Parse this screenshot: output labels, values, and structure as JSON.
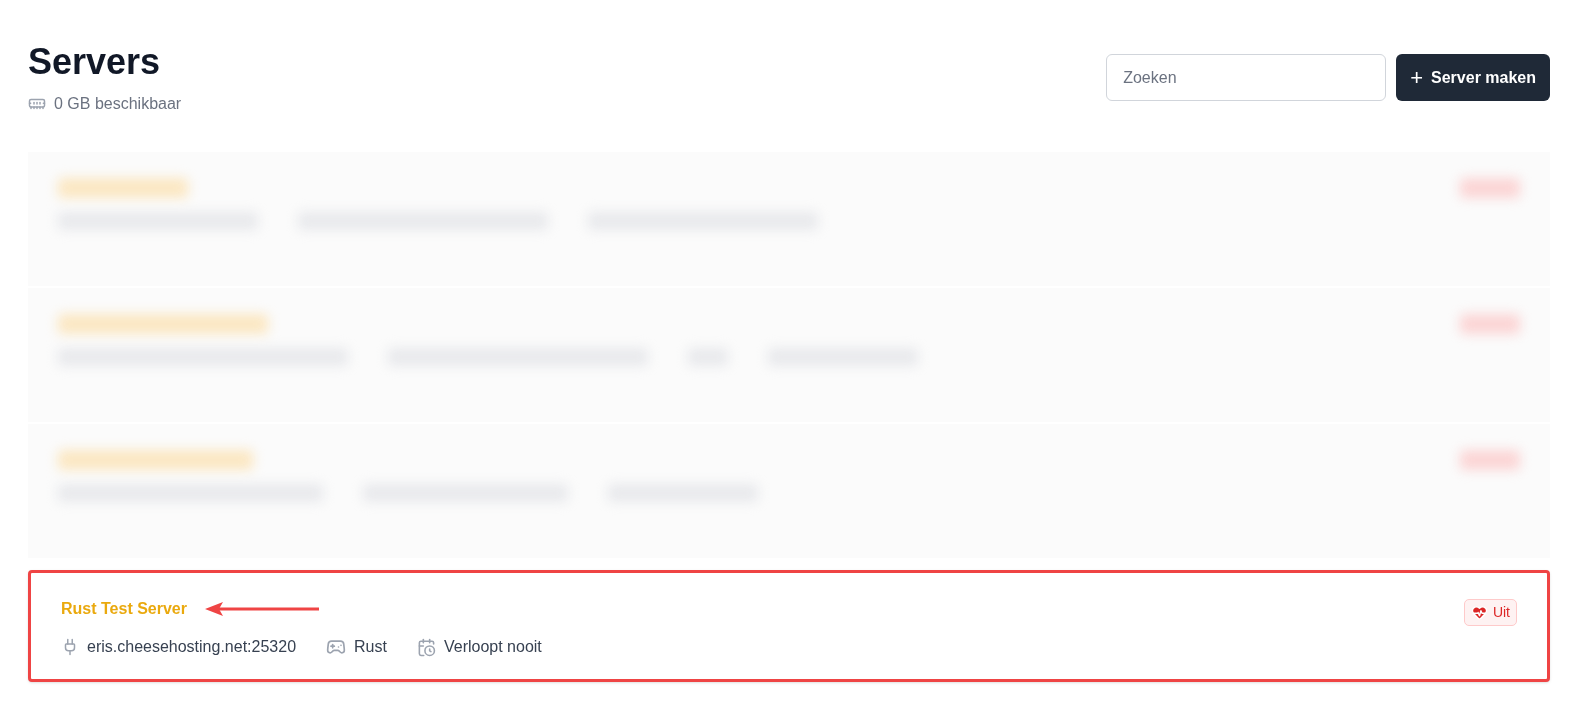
{
  "header": {
    "title": "Servers",
    "memory": "0 GB beschikbaar"
  },
  "search": {
    "placeholder": "Zoeken"
  },
  "create_button": {
    "label": "Server maken",
    "icon": "+"
  },
  "servers": [
    {
      "kind": "blurred"
    },
    {
      "kind": "blurred"
    },
    {
      "kind": "blurred"
    },
    {
      "kind": "card",
      "name": "Rust Test Server",
      "address": "eris.cheesehosting.net:25320",
      "game": "Rust",
      "expiry": "Verloopt nooit",
      "status": "Uit",
      "highlighted": true
    }
  ]
}
